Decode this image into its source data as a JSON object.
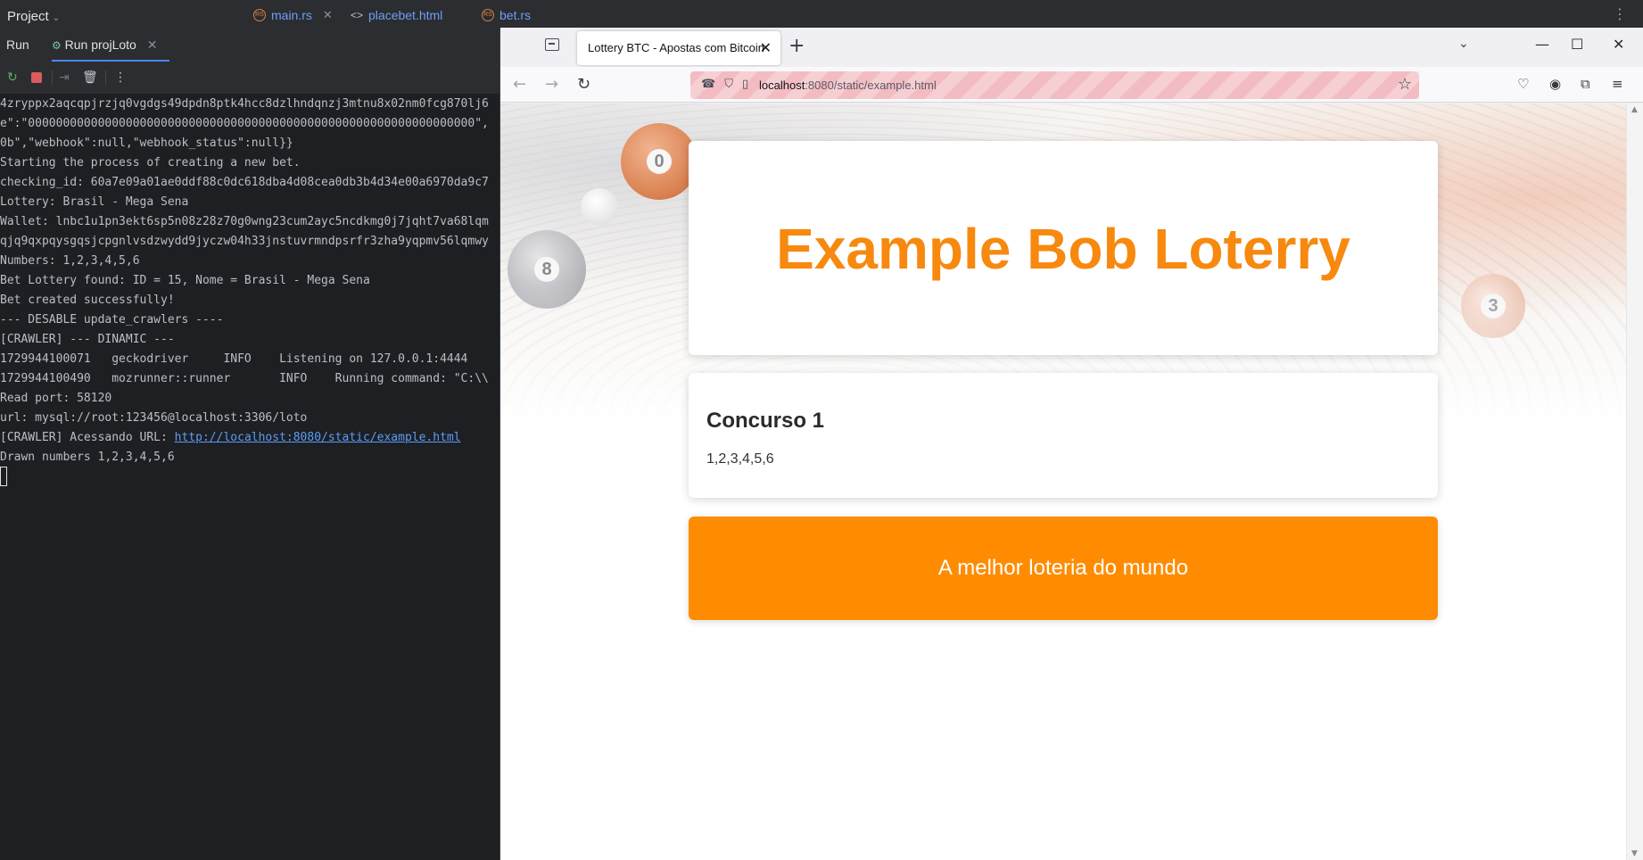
{
  "ide": {
    "project_label": "Project",
    "editor_tabs": [
      {
        "label": "main.rs"
      },
      {
        "label": "placebet.html"
      },
      {
        "label": "bet.rs"
      }
    ],
    "run_title": "Run",
    "run_tab_label": "Run projLoto",
    "console_lines": [
      "4zryppx2aqcqpjrzjq0vgdgs49dpdn8ptk4hcc8dzlhndqnzj3mtnu8x02nm0fcg870lj6",
      "e\":\"0000000000000000000000000000000000000000000000000000000000000000\",",
      "0b\",\"webhook\":null,\"webhook_status\":null}}",
      "Starting the process of creating a new bet.",
      "checking_id: 60a7e09a01ae0ddf88c0dc618dba4d08cea0db3b4d34e00a6970da9c7",
      "Lottery: Brasil - Mega Sena",
      "Wallet: lnbc1u1pn3ekt6sp5n08z28z70g0wng23cum2ayc5ncdkmg0j7jqht7va68lqm",
      "qjq9qxpqysgqsjcpgnlvsdzwydd9jyczw04h33jnstuvrmndpsrfr3zha9yqpmv56lqmwy",
      "Numbers: 1,2,3,4,5,6",
      "Bet Lottery found: ID = 15, Nome = Brasil - Mega Sena",
      "Bet created successfully!",
      "--- DESABLE update_crawlers ----",
      "[CRAWLER] --- DINAMIC ---",
      "1729944100071   geckodriver     INFO    Listening on 127.0.0.1:4444",
      "1729944100490   mozrunner::runner       INFO    Running command: \"C:\\\\",
      "Read port: 58120",
      "url: mysql://root:123456@localhost:3306/loto",
      "[CRAWLER] Acessando URL: ",
      "Drawn numbers 1,2,3,4,5,6"
    ],
    "console_link": "http://localhost:8080/static/example.html"
  },
  "browser": {
    "tab_title": "Lottery BTC - Apostas com Bitcoin",
    "url_host": "localhost",
    "url_path": ":8080/static/example.html",
    "page": {
      "title": "Example Bob Loterry",
      "draw_title": "Concurso 1",
      "draw_numbers": "1,2,3,4,5,6",
      "footer": "A melhor loteria do mundo",
      "ball_labels": [
        "0",
        "8",
        "3"
      ]
    }
  },
  "colors": {
    "accent_orange": "#ff8c00",
    "title_orange": "#f7890f",
    "ide_bg": "#1e1f22",
    "link_blue": "#5a9cf8"
  },
  "icons": [
    "rerun-icon",
    "stop-icon",
    "scroll-icon",
    "trash-icon",
    "more-icon",
    "tab-list-icon",
    "close-icon",
    "plus-icon",
    "chevron-down-icon",
    "minimize-icon",
    "maximize-icon",
    "back-icon",
    "forward-icon",
    "reload-icon",
    "shield-icon",
    "page-icon",
    "star-icon",
    "pocket-icon",
    "account-icon",
    "extensions-icon",
    "menu-icon"
  ]
}
